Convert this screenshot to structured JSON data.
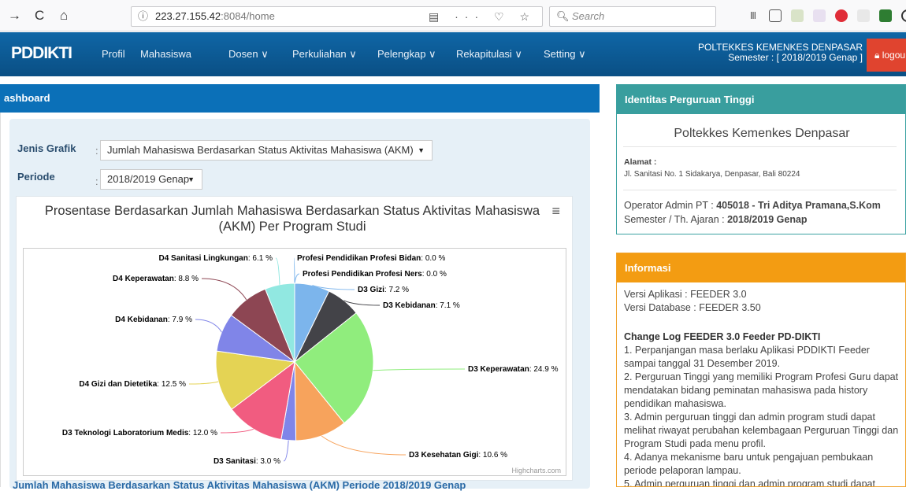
{
  "browser": {
    "back": "→",
    "reload": "C",
    "home": "⌂",
    "url_host": "223.27.155.42",
    "url_rest": ":8084/home",
    "search_placeholder": "Search"
  },
  "navbar": {
    "brand": "PDDIKTI",
    "items": [
      "Profil",
      "Mahasiswa",
      "Dosen ∨",
      "Perkuliahan ∨",
      "Pelengkap ∨",
      "Rekapitulasi ∨",
      "Setting ∨"
    ],
    "campus": "POLTEKKES KEMENKES DENPASAR",
    "semester": "Semester : [ 2018/2019 Genap ]",
    "logout": "logou"
  },
  "dashboard": {
    "title": "ashboard",
    "jenis_label": "Jenis Grafik",
    "jenis_value": "Jumlah Mahasiswa Berdasarkan Status Aktivitas Mahasiswa (AKM)",
    "periode_label": "Periode",
    "periode_value": "2018/2019 Genap",
    "chart_title_1": "Prosentase Berdasarkan Jumlah Mahasiswa Berdasarkan Status Aktivitas Mahasiswa",
    "chart_title_2": "(AKM) Per Program Studi",
    "credits": "Highcharts.com",
    "bottom_caption": "Jumlah Mahasiswa Berdasarkan Status Aktivitas Mahasiswa (AKM) Periode 2018/2019 Genap"
  },
  "chart_data": {
    "type": "pie",
    "title": "Prosentase Berdasarkan Jumlah Mahasiswa Berdasarkan Status Aktivitas Mahasiswa (AKM) Per Program Studi",
    "slices": [
      {
        "name": "Profesi Pendidikan Profesi Bidan",
        "value": 0.0,
        "color": "#7cb5ec"
      },
      {
        "name": "Profesi Pendidikan Profesi Ners",
        "value": 0.0,
        "color": "#7cb5ec"
      },
      {
        "name": "D3 Gizi",
        "value": 7.2,
        "color": "#7cb5ec"
      },
      {
        "name": "D3 Kebidanan",
        "value": 7.1,
        "color": "#434348"
      },
      {
        "name": "D3 Keperawatan",
        "value": 24.9,
        "color": "#90ed7d"
      },
      {
        "name": "D3 Kesehatan Gigi",
        "value": 10.6,
        "color": "#f7a35c"
      },
      {
        "name": "D3 Sanitasi",
        "value": 3.0,
        "color": "#8085e9"
      },
      {
        "name": "D3 Teknologi Laboratorium Medis",
        "value": 12.0,
        "color": "#f15c80"
      },
      {
        "name": "D4 Gizi dan Dietetika",
        "value": 12.5,
        "color": "#e4d354"
      },
      {
        "name": "D4 Kebidanan",
        "value": 7.9,
        "color": "#8085e8"
      },
      {
        "name": "D4 Keperawatan",
        "value": 8.8,
        "color": "#8d4653"
      },
      {
        "name": "D4 Sanitasi Lingkungan",
        "value": 6.1,
        "color": "#91e8e1"
      }
    ]
  },
  "identitas": {
    "title": "Identitas Perguruan Tinggi",
    "name": "Poltekkes Kemenkes Denpasar",
    "alamat_label": "Alamat :",
    "alamat": "Jl. Sanitasi No. 1 Sidakarya, Denpasar, Bali 80224",
    "operator_label": "Operator Admin PT : ",
    "operator": "405018 - Tri Aditya Pramana,S.Kom",
    "semester_label": "Semester / Th. Ajaran : ",
    "semester": "2018/2019 Genap"
  },
  "informasi": {
    "title": "Informasi",
    "versi_app": "Versi Aplikasi : FEEDER 3.0",
    "versi_db": "Versi Database : FEEDER 3.50",
    "changelog_title": "Change Log FEEDER 3.0 Feeder PD-DIKTI",
    "changelog": "1. Perpanjangan masa berlaku Aplikasi PDDIKTI Feeder sampai tanggal 31 Desember 2019.\n2. Perguruan Tinggi yang memiliki Program Profesi Guru dapat mendatakan bidang peminatan mahasiswa pada history pendidikan mahasiswa.\n3. Admin perguruan tinggi dan admin program studi dapat melihat riwayat perubahan kelembagaan Perguruan Tinggi dan Program Studi pada menu profil.\n4. Adanya mekanisme baru untuk pengajuan pembukaan periode pelaporan lampau.\n5. Admin perguruan tinggi dan admin program studi dapat"
  }
}
